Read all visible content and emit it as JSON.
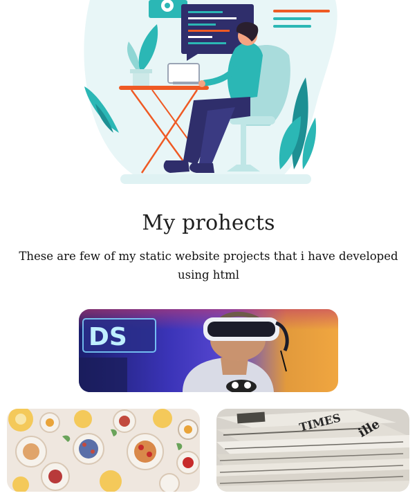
{
  "header": {
    "title": "My prohects",
    "subtitle": "These are few of my static website projects that i have developed using html"
  },
  "projects": [
    {
      "image": "vr-headset-photo"
    },
    {
      "image": "food-table-photo"
    },
    {
      "image": "newspaper-stack-photo"
    }
  ],
  "colors": {
    "accent_teal": "#2bb7b5",
    "accent_orange": "#ef5a24",
    "navy": "#2f2e6b",
    "text": "#1f1f1f"
  }
}
